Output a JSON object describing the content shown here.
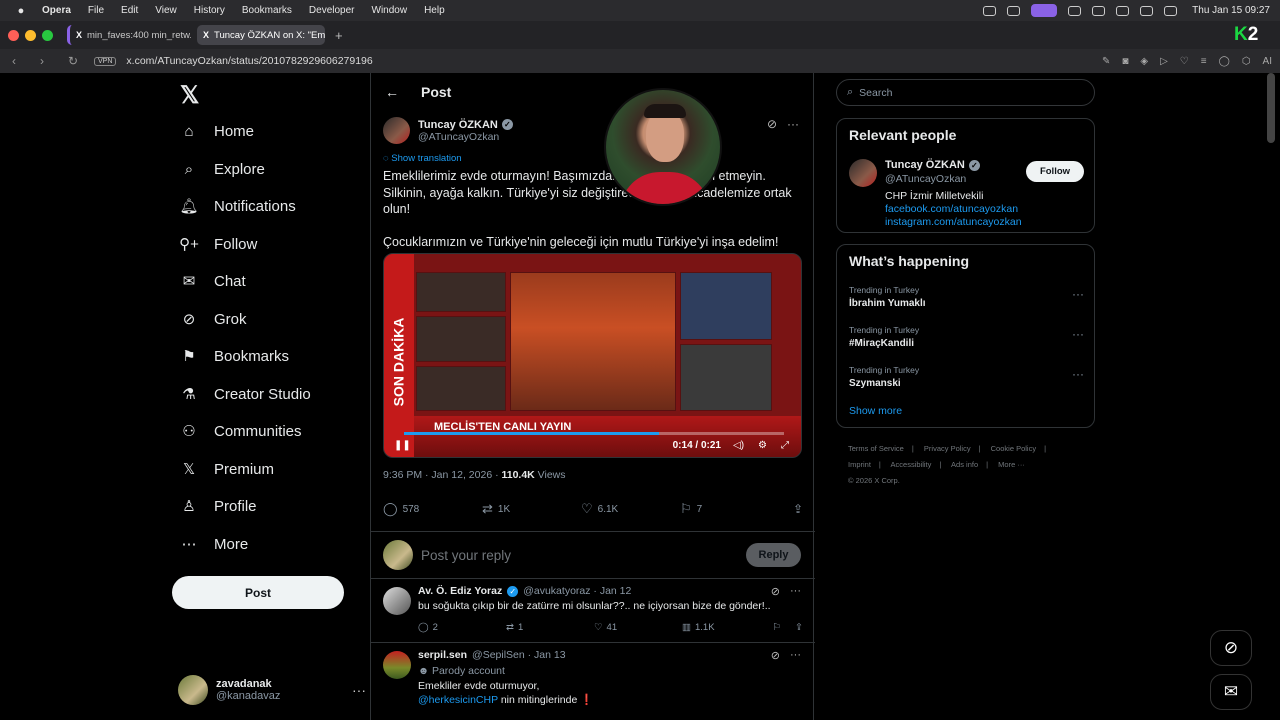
{
  "menubar": {
    "app": "Opera",
    "items": [
      "File",
      "Edit",
      "View",
      "History",
      "Bookmarks",
      "Developer",
      "Window",
      "Help"
    ],
    "clock": "Thu Jan 15  09:27"
  },
  "tabs": [
    {
      "label": "min_faves:400 min_retw...",
      "active": false
    },
    {
      "label": "Tuncay ÖZKAN on X: \"Em...",
      "active": true
    }
  ],
  "addressbar": {
    "url": "x.com/ATuncayOzkan/status/2010782929606279196",
    "vpn": "VPN",
    "ai": "AI"
  },
  "nav": {
    "items": [
      "Home",
      "Explore",
      "Notifications",
      "Follow",
      "Chat",
      "Grok",
      "Bookmarks",
      "Creator Studio",
      "Communities",
      "Premium",
      "Profile",
      "More"
    ],
    "post_button": "Post",
    "account_name": "zavadanak",
    "account_handle": "@kanadavaz"
  },
  "post": {
    "header": "Post",
    "author": "Tuncay ÖZKAN",
    "handle": "@ATuncayOzkan",
    "show_translation": "Show translation",
    "text1": "Emeklilerimiz evde oturmayın! Başımızdaki bu felaketi kabul etmeyin. Silkinin, ayağa kalkın. Türkiye'yi siz değiştireceksiniz. Mücadelemize ortak olun!",
    "text2": "Çocuklarımızın ve Türkiye'nin geleceği için mutlu Türkiye'yi inşa edelim!",
    "video": {
      "banner": "SON DAKİKA",
      "headline": "MECLİS'TEN CANLI YAYIN",
      "time": "0:14 / 0:21",
      "progress": 0.67
    },
    "timestamp": "9:36 PM · Jan 12, 2026 · ",
    "views_count": "110.4K",
    "views_label": " Views",
    "stats": {
      "replies": "578",
      "reposts": "1K",
      "likes": "6.1K",
      "bookmarks": "7"
    },
    "reply_placeholder": "Post your reply",
    "reply_button": "Reply"
  },
  "comments": [
    {
      "name": "Av. Ö. Ediz Yoraz",
      "handle": "@avukatyoraz · Jan 12",
      "text": "bu soğukta çıkıp bir de zatürre mi olsunlar??.. ne içiyorsan bize de gönder!..",
      "replies": "2",
      "reposts": "1",
      "likes": "41",
      "views": "1.1K"
    },
    {
      "name": "serpil.sen",
      "handle": "@SepilSen · Jan 13",
      "badge": "Parody account",
      "text": "Emekliler evde oturmuyor,",
      "mention": "@herkesicinCHP",
      "text2": " nin mitinglerinde ❗"
    }
  ],
  "sidebar": {
    "search_placeholder": "Search",
    "relevant_title": "Relevant people",
    "person": {
      "name": "Tuncay ÖZKAN",
      "handle": "@ATuncayOzkan",
      "bio": "CHP İzmir Milletvekili",
      "link1": "facebook.com/atuncayozkan",
      "link2": "instagram.com/atuncayozkan",
      "follow": "Follow"
    },
    "happening_title": "What’s happening",
    "trends": [
      {
        "label": "Trending in Turkey",
        "topic": "İbrahim Yumaklı"
      },
      {
        "label": "Trending in Turkey",
        "topic": "#MiraçKandili"
      },
      {
        "label": "Trending in Turkey",
        "topic": "Szymanski"
      }
    ],
    "show_more": "Show more",
    "footer": [
      "Terms of Service",
      "|",
      "Privacy Policy",
      "|",
      "Cookie Policy",
      "|",
      "Imprint",
      "|",
      "Accessibility",
      "|",
      "Ads info",
      "|",
      "More ···",
      "© 2026 X Corp."
    ]
  },
  "colors": {
    "accent": "#1d9bf0",
    "background": "#000000",
    "brand_badge": "#1bd742"
  }
}
